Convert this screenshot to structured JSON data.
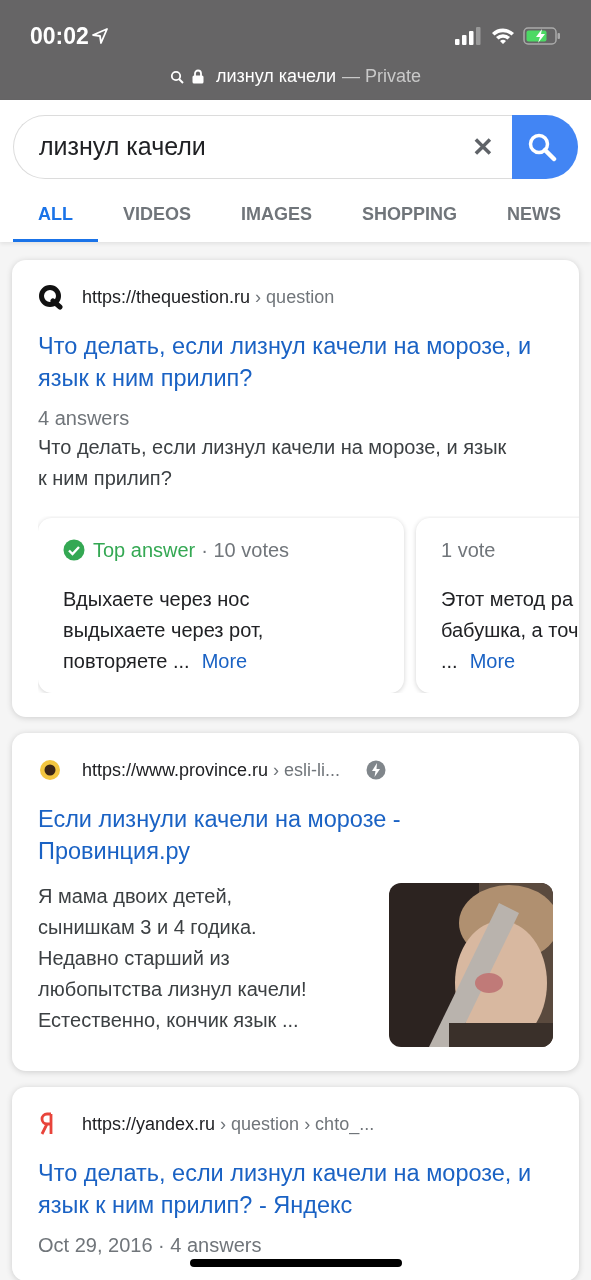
{
  "status_bar": {
    "time": "00:02"
  },
  "address_bar": {
    "query": "лизнул качели",
    "mode": "— Private"
  },
  "search": {
    "value": "лизнул качели",
    "clear": "✕"
  },
  "tabs": [
    {
      "label": "ALL",
      "selected": true
    },
    {
      "label": "VIDEOS",
      "selected": false
    },
    {
      "label": "IMAGES",
      "selected": false
    },
    {
      "label": "SHOPPING",
      "selected": false
    },
    {
      "label": "NEWS",
      "selected": false
    }
  ],
  "results": [
    {
      "kind": "qa",
      "site": "https://thequestion.ru",
      "path": "› question",
      "title": "Что делать, если лизнул качели на морозе, и язык к ним прилип?",
      "meta": "4 answers",
      "snippet": "Что делать, если лизнул качели на морозе, и язык к ним прилип?",
      "answers": [
        {
          "top": true,
          "badge": "Top answer",
          "votes": "· 10 votes",
          "lines": [
            "Вдыхаете через нос",
            "выдыхаете через рот,",
            "повторяете ..."
          ],
          "more": "More"
        },
        {
          "top": false,
          "votes": "1 vote",
          "lines": [
            "Этот метод ра",
            "бабушка, а точ",
            "..."
          ],
          "more": "More"
        }
      ]
    },
    {
      "site": "https://www.province.ru",
      "path": "› esli-li...",
      "amp": true,
      "title": "Если лизнули качели на морозе - Провинция.ру",
      "lines": [
        "Я мама двоих детей,",
        "сынишкам 3 и 4 годика.",
        "Недавно старший из",
        "любопытства лизнул качели!",
        "Естественно, кончик язык ..."
      ]
    },
    {
      "kind": "plain",
      "site": "https://yandex.ru",
      "path": "› question › chto_...",
      "title": "Что делать, если лизнул качели на морозе, и язык к ним прилип? - Яндекс",
      "meta": "Oct 29, 2016 · 4 answers"
    }
  ]
}
